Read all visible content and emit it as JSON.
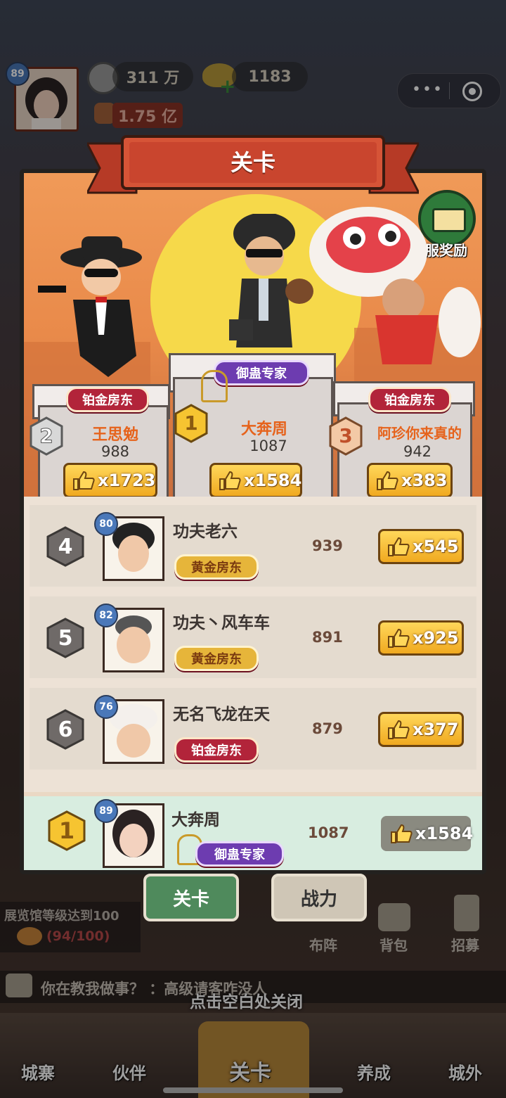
{
  "hud": {
    "player_level": "89",
    "silver": "311 万",
    "gold": "1183",
    "power": "1.75 亿"
  },
  "panel": {
    "title": "关卡",
    "server_reward_label": "全服奖励"
  },
  "podium": [
    {
      "rank": "2",
      "name": "王思勉",
      "score": "988",
      "title": "铂金房东",
      "likes": "x1723"
    },
    {
      "rank": "1",
      "name": "大奔周",
      "score": "1087",
      "title": "御蛊专家",
      "likes": "x1584"
    },
    {
      "rank": "3",
      "name": "阿珍你来真的",
      "score": "942",
      "title": "铂金房东",
      "likes": "x383"
    }
  ],
  "rows": [
    {
      "rank": "4",
      "level": "80",
      "name": "功夫老六",
      "title": "黄金房东",
      "score": "939",
      "likes": "x545"
    },
    {
      "rank": "5",
      "level": "82",
      "name": "功夫丶风车车",
      "title": "黄金房东",
      "score": "891",
      "likes": "x925"
    },
    {
      "rank": "6",
      "level": "76",
      "name": "无名飞龙在天",
      "title": "铂金房东",
      "score": "879",
      "likes": "x377"
    }
  ],
  "my_rank": {
    "rank": "1",
    "level": "89",
    "name": "大奔周",
    "title": "御蛊专家",
    "score": "1087",
    "likes": "x1584"
  },
  "tabs": {
    "stage": "关卡",
    "power": "战力"
  },
  "background": {
    "exhibit_text": "展览馆等级达到100",
    "exhibit_progress": "(94/100)",
    "formation": "布阵",
    "backpack": "背包",
    "recruit": "招募",
    "chat": "你在教我做事？ ：高级请客咋没人",
    "close_hint": "点击空白处关闭"
  },
  "bottom_nav": [
    "城寨",
    "伙伴",
    "关卡",
    "养成",
    "城外"
  ],
  "colors": {
    "accent_orange": "#e6631c",
    "ribbon_red": "#c9452e",
    "tab_green": "#4f8a5c",
    "like_gold": "#f0a920"
  }
}
